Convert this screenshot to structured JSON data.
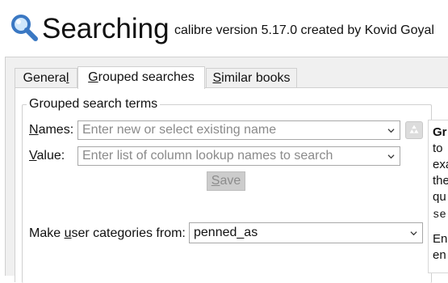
{
  "header": {
    "title": "Searching",
    "subtitle": "calibre version 5.17.0 created by Kovid Goyal",
    "logo_icon": "search-magnifier-icon"
  },
  "tabs": [
    {
      "pre": "Genera",
      "u": "l",
      "post": "",
      "active": false
    },
    {
      "pre": "",
      "u": "G",
      "post": "rouped searches",
      "active": true
    },
    {
      "pre": "",
      "u": "S",
      "post": "imilar books",
      "active": false
    }
  ],
  "group": {
    "title": "Grouped search terms",
    "names": {
      "label_u": "N",
      "label_rest": "ames:",
      "placeholder": "Enter new or select existing name"
    },
    "value": {
      "label_u": "V",
      "label_rest": "alue:",
      "placeholder": "Enter list of column lookup names to search"
    },
    "save": {
      "u": "S",
      "rest": "ave"
    },
    "delete_icon": "recycle-icon"
  },
  "categories": {
    "label_pre": "Make ",
    "label_u": "u",
    "label_post": "ser categories from:",
    "value": "penned_as"
  },
  "help": {
    "lines": [
      "Gr",
      "to",
      "exa",
      "the",
      "qu",
      "se",
      "",
      "En",
      "en"
    ]
  },
  "colors": {
    "accent": "#3a78c3",
    "disabled_button": "#cccccc",
    "border": "#d0d0d0"
  }
}
